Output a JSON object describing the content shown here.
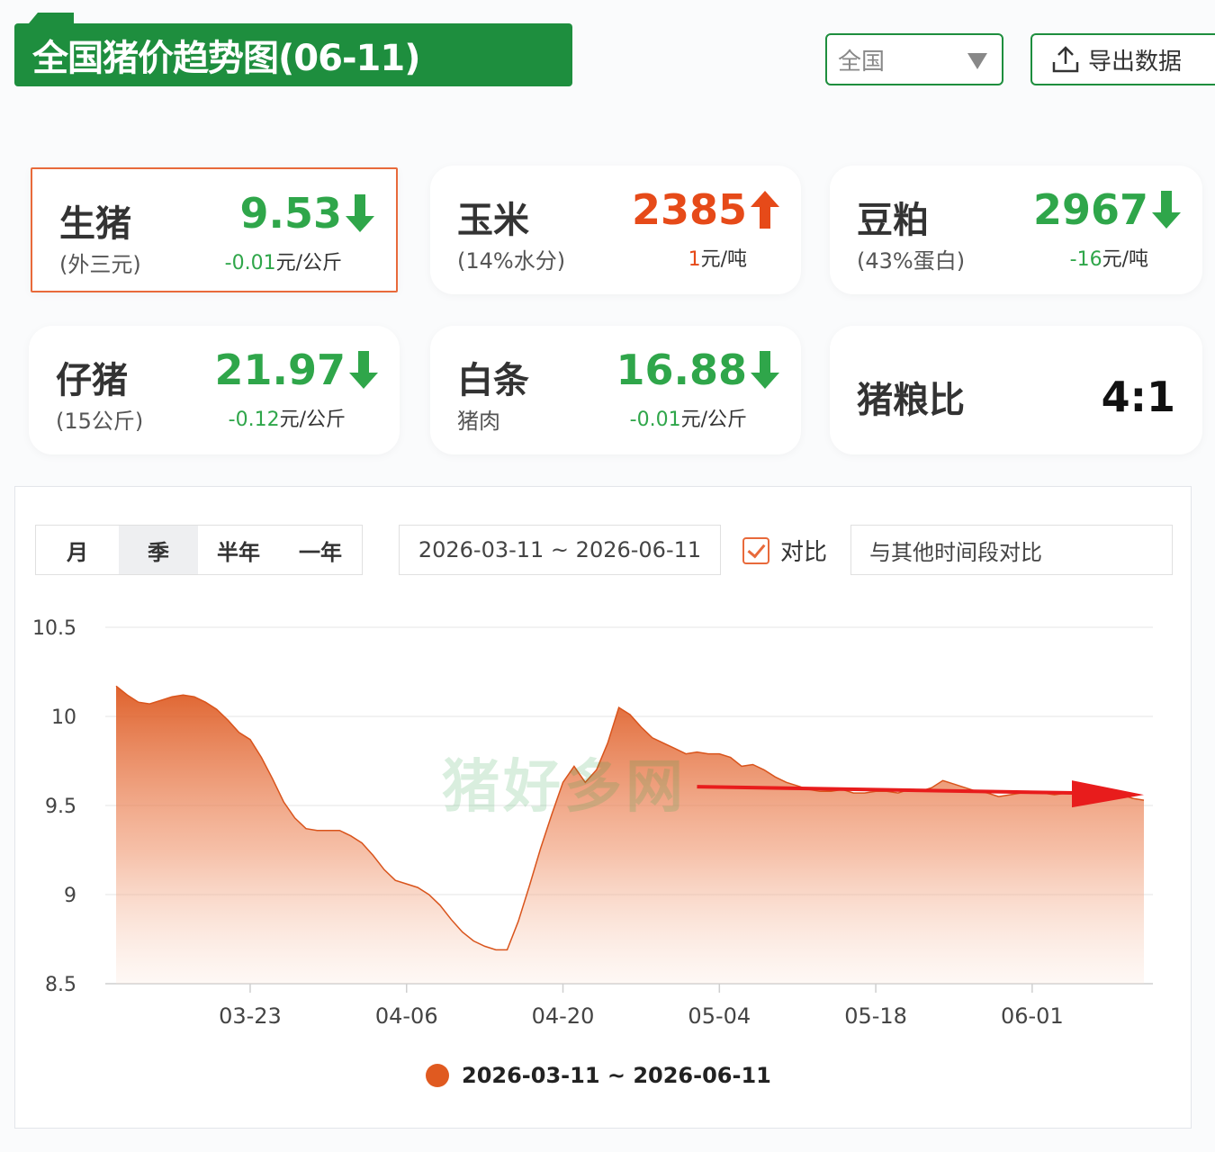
{
  "header": {
    "title": "全国猪价趋势图(06-11)",
    "region": "全国",
    "export_label": "导出数据"
  },
  "cards": [
    {
      "name": "生猪",
      "sub": "(外三元)",
      "value": "9.53",
      "change": "-0.01",
      "unit": "元/公斤",
      "trend": "down",
      "active": true
    },
    {
      "name": "玉米",
      "sub": "(14%水分)",
      "value": "2385",
      "change": "1",
      "unit": "元/吨",
      "trend": "up",
      "active": false
    },
    {
      "name": "豆粕",
      "sub": "(43%蛋白)",
      "value": "2967",
      "change": "-16",
      "unit": "元/吨",
      "trend": "down",
      "active": false
    },
    {
      "name": "仔猪",
      "sub": "(15公斤)",
      "value": "21.97",
      "change": "-0.12",
      "unit": "元/公斤",
      "trend": "down",
      "active": false
    },
    {
      "name": "白条",
      "sub": "猪肉",
      "value": "16.88",
      "change": "-0.01",
      "unit": "元/公斤",
      "trend": "down",
      "active": false
    },
    {
      "name": "猪粮比",
      "sub": "",
      "value": "4:1",
      "change": "",
      "unit": "",
      "trend": "none",
      "active": false
    }
  ],
  "controls": {
    "tabs": [
      "月",
      "季",
      "半年",
      "一年"
    ],
    "selected_tab": "季",
    "date_range": "2026-03-11 ~ 2026-06-11",
    "compare_label": "对比",
    "compare_checked": true,
    "other_range_placeholder": "与其他时间段对比"
  },
  "watermark": "猪好多网",
  "colors": {
    "brand_green": "#1e8e3e",
    "down_green": "#2fa64a",
    "up_red": "#e64a19",
    "series": "#e05a20",
    "trend_arrow": "#e81c1c"
  },
  "chart_data": {
    "type": "area",
    "title": "",
    "xlabel": "",
    "ylabel": "",
    "ylim": [
      8.5,
      10.5
    ],
    "yticks": [
      "10.5",
      "10",
      "9.5",
      "9",
      "8.5"
    ],
    "xticks": [
      "03-23",
      "04-06",
      "04-20",
      "05-04",
      "05-18",
      "06-01"
    ],
    "grid": true,
    "legend": "bottom-center",
    "series": [
      {
        "name": "2026-03-11 ~ 2026-06-11",
        "x": [
          "03-11",
          "03-12",
          "03-13",
          "03-14",
          "03-15",
          "03-16",
          "03-17",
          "03-18",
          "03-19",
          "03-20",
          "03-21",
          "03-22",
          "03-23",
          "03-24",
          "03-25",
          "03-26",
          "03-27",
          "03-28",
          "03-29",
          "03-30",
          "03-31",
          "04-01",
          "04-02",
          "04-03",
          "04-04",
          "04-05",
          "04-06",
          "04-07",
          "04-08",
          "04-09",
          "04-10",
          "04-11",
          "04-12",
          "04-13",
          "04-14",
          "04-15",
          "04-16",
          "04-17",
          "04-18",
          "04-19",
          "04-20",
          "04-21",
          "04-22",
          "04-23",
          "04-24",
          "04-25",
          "04-26",
          "04-27",
          "04-28",
          "04-29",
          "04-30",
          "05-01",
          "05-02",
          "05-03",
          "05-04",
          "05-05",
          "05-06",
          "05-07",
          "05-08",
          "05-09",
          "05-10",
          "05-11",
          "05-12",
          "05-13",
          "05-14",
          "05-15",
          "05-16",
          "05-17",
          "05-18",
          "05-19",
          "05-20",
          "05-21",
          "05-22",
          "05-23",
          "05-24",
          "05-25",
          "05-26",
          "05-27",
          "05-28",
          "05-29",
          "05-30",
          "05-31",
          "06-01",
          "06-02",
          "06-03",
          "06-04",
          "06-05",
          "06-06",
          "06-07",
          "06-08",
          "06-09",
          "06-10",
          "06-11"
        ],
        "values": [
          10.17,
          10.12,
          10.08,
          10.07,
          10.09,
          10.11,
          10.12,
          10.11,
          10.08,
          10.04,
          9.98,
          9.91,
          9.87,
          9.77,
          9.65,
          9.52,
          9.43,
          9.37,
          9.36,
          9.36,
          9.36,
          9.33,
          9.29,
          9.22,
          9.14,
          9.08,
          9.06,
          9.04,
          9.0,
          8.94,
          8.86,
          8.79,
          8.74,
          8.71,
          8.69,
          8.69,
          8.85,
          9.05,
          9.26,
          9.45,
          9.63,
          9.72,
          9.63,
          9.7,
          9.85,
          10.05,
          10.01,
          9.94,
          9.88,
          9.85,
          9.82,
          9.79,
          9.8,
          9.79,
          9.79,
          9.77,
          9.72,
          9.73,
          9.7,
          9.66,
          9.63,
          9.61,
          9.59,
          9.58,
          9.58,
          9.59,
          9.57,
          9.57,
          9.58,
          9.58,
          9.57,
          9.59,
          9.58,
          9.6,
          9.64,
          9.62,
          9.6,
          9.58,
          9.57,
          9.55,
          9.56,
          9.57,
          9.58,
          9.57,
          9.56,
          9.57,
          9.58,
          9.56,
          9.55,
          9.57,
          9.56,
          9.54,
          9.53
        ]
      }
    ],
    "annotation": {
      "type": "trend-arrow",
      "from": "05-02",
      "to": "06-11",
      "y": 9.57
    }
  }
}
